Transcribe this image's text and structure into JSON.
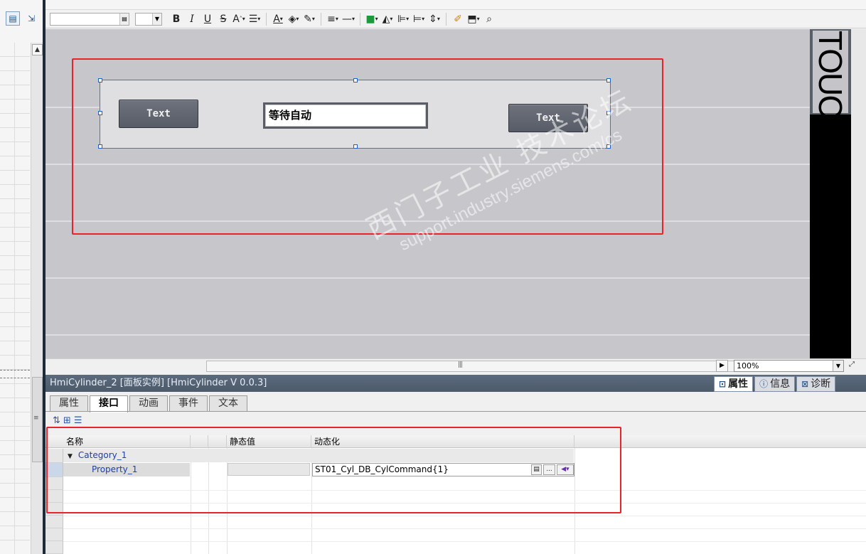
{
  "toolbar": {
    "bold": "B",
    "italic": "I",
    "underline": "U",
    "strike": "S",
    "font_grow": "A",
    "text_color": "A"
  },
  "canvas": {
    "faceplate": {
      "button_left_label": "Text",
      "button_right_label": "Text",
      "io_field_value": "等待自动"
    },
    "side_text": "TOUCH",
    "watermark_line1": "西门子工业  技术论坛",
    "watermark_line2": "support.industry.siemens.com/cs"
  },
  "zoom": {
    "value": "100%"
  },
  "panel": {
    "title": "HmiCylinder_2 [面板实例] [HmiCylinder V 0.0.3]",
    "right_tabs": [
      {
        "label": "属性",
        "icon": "properties-icon",
        "active": true
      },
      {
        "label": "信息",
        "icon": "info-icon",
        "active": false
      },
      {
        "label": "诊断",
        "icon": "diagnostics-icon",
        "active": false
      }
    ],
    "sub_tabs": [
      {
        "label": "属性",
        "active": false
      },
      {
        "label": "接口",
        "active": true
      },
      {
        "label": "动画",
        "active": false
      },
      {
        "label": "事件",
        "active": false
      },
      {
        "label": "文本",
        "active": false
      }
    ]
  },
  "grid": {
    "columns": {
      "name": "名称",
      "static_value": "静态值",
      "dynamization": "动态化"
    },
    "category": "Category_1",
    "property": {
      "name": "Property_1",
      "static_value": "",
      "dynamization": "ST01_Cyl_DB_CylCommand{1}"
    },
    "ellipsis": "..."
  },
  "colors": {
    "highlight_box": "#e8242a",
    "canvas_bg": "#c7c7cb",
    "panel_header": "#52606f"
  }
}
